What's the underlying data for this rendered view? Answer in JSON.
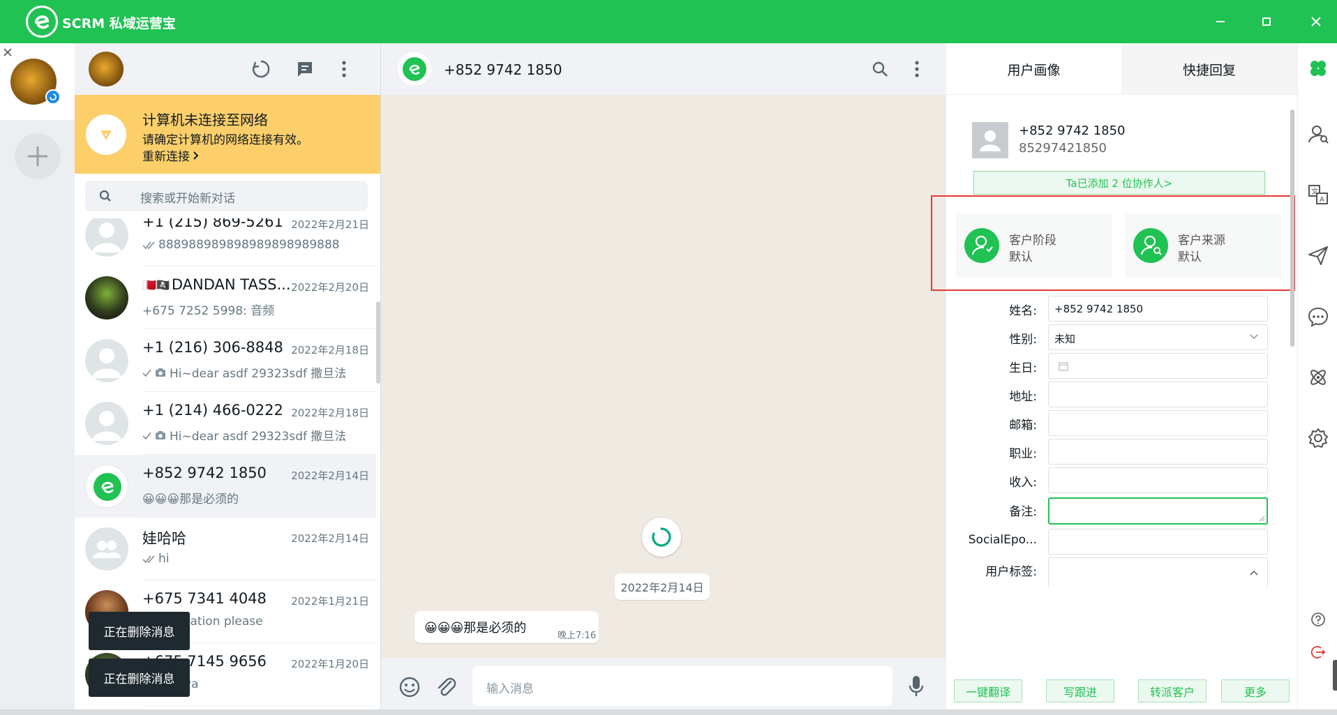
{
  "app": {
    "title": "SCRM 私域运营宝"
  },
  "colors": {
    "brand": "#20c253",
    "banner": "#fdcf6b",
    "highlight_box": "#e53935",
    "toast_bg": "#1f2a30"
  },
  "window_controls": {
    "minimize": "minimize-icon",
    "maximize": "maximize-icon",
    "close": "close-icon"
  },
  "banner": {
    "title": "计算机未连接至网络",
    "subtitle": "请确定计算机的网络连接有效。",
    "link": "重新连接"
  },
  "search": {
    "placeholder": "搜索或开始新对话"
  },
  "chats": [
    {
      "name": "+1 (215) 869-5261",
      "date": "2022年2月21日",
      "preview": "888988989898989898989888",
      "status": "double-check"
    },
    {
      "name": "DANDAN TASS...",
      "date": "2022年2月20日",
      "preview": "+675 7252 5998: 音频",
      "flags": "🇧🇭🏴‍☠️"
    },
    {
      "name": "+1 (216) 306-8848",
      "date": "2022年2月18日",
      "preview": "Hi~dear asdf 29323sdf 撒旦法",
      "status": "check"
    },
    {
      "name": "+1 (214) 466-0222",
      "date": "2022年2月18日",
      "preview": "Hi~dear asdf 29323sdf 撒旦法",
      "status": "check"
    },
    {
      "name": "+852 9742 1850",
      "date": "2022年2月14日",
      "preview": "😀😀😀那是必须的",
      "selected": true
    },
    {
      "name": "娃哈哈",
      "date": "2022年2月14日",
      "preview": "hi",
      "status": "double-check"
    },
    {
      "name": "+675 7341 4048",
      "date": "2022年1月21日",
      "preview": "Identification please"
    },
    {
      "name": "+675 7145 9656",
      "date": "2022年1月20日",
      "preview": "Russia ya"
    }
  ],
  "toasts": [
    "正在删除消息",
    "正在删除消息"
  ],
  "chat": {
    "title": "+852 9742 1850",
    "date_chip": "2022年2月14日",
    "message": {
      "text": "😀😀😀那是必须的",
      "time": "晚上7:16"
    },
    "input_placeholder": "输入消息"
  },
  "right_panel": {
    "tabs": [
      "用户画像",
      "快捷回复"
    ],
    "profile": {
      "name": "+852 9742 1850",
      "id": "85297421850"
    },
    "collab_button": "Ta已添加 2 位协作人>",
    "cards": [
      {
        "title": "客户阶段",
        "value": "默认"
      },
      {
        "title": "客户来源",
        "value": "默认"
      }
    ],
    "form": {
      "name_label": "姓名:",
      "name_value": "+852 9742 1850",
      "gender_label": "性别:",
      "gender_value": "未知",
      "birthday_label": "生日:",
      "address_label": "地址:",
      "email_label": "邮箱:",
      "job_label": "职业:",
      "income_label": "收入:",
      "note_label": "备注:",
      "social_label": "SocialEpo...",
      "tags_label": "用户标签:"
    },
    "actions": [
      "一键翻译",
      "写跟进",
      "转派客户",
      "更多"
    ]
  },
  "side_toolbar": [
    "clover-icon",
    "user-search-icon",
    "translate-icon",
    "send-icon",
    "chat-bubble-icon",
    "atom-icon",
    "gear-icon",
    "help-icon",
    "logout-icon"
  ]
}
